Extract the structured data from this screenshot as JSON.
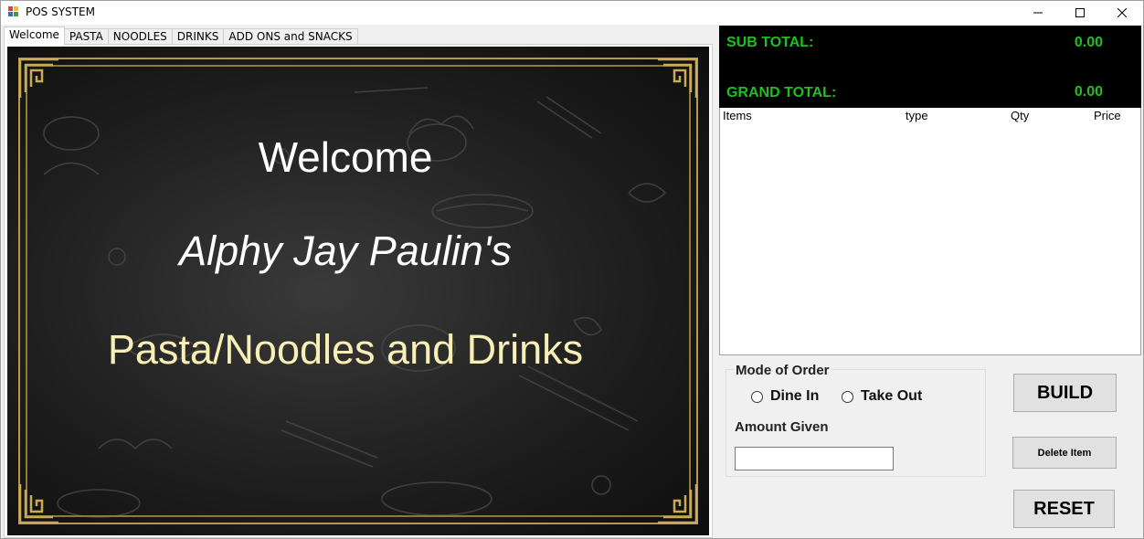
{
  "window": {
    "title": "POS SYSTEM",
    "icon": "app-icon",
    "controls": [
      "minimize-icon",
      "maximize-icon",
      "close-icon"
    ]
  },
  "tabs": [
    {
      "label": "Welcome",
      "active": true
    },
    {
      "label": "PASTA",
      "active": false
    },
    {
      "label": "NOODLES",
      "active": false
    },
    {
      "label": "DRINKS",
      "active": false
    },
    {
      "label": "ADD ONS and SNACKS",
      "active": false
    }
  ],
  "welcome": {
    "heading": "Welcome",
    "owner": "Alphy Jay Paulin's",
    "shop": "Pasta/Noodles and Drinks"
  },
  "totals": {
    "subtotal_label": "SUB TOTAL:",
    "subtotal_value": "0.00",
    "grand_label": "GRAND TOTAL:",
    "grand_value": "0.00",
    "text_color": "#1fbf1f",
    "background": "#000000"
  },
  "order_list": {
    "columns": [
      "Items",
      "type",
      "Qty",
      "Price"
    ],
    "rows": []
  },
  "mode_of_order": {
    "title": "Mode of Order",
    "options": [
      "Dine In",
      "Take Out"
    ],
    "selected": null
  },
  "amount_given": {
    "label": "Amount Given",
    "value": ""
  },
  "buttons": {
    "build": "BUILD",
    "delete": "Delete Item",
    "reset": "RESET"
  },
  "colors": {
    "frame_gold": "#b69a4a",
    "shop_text": "#f7efb5"
  }
}
